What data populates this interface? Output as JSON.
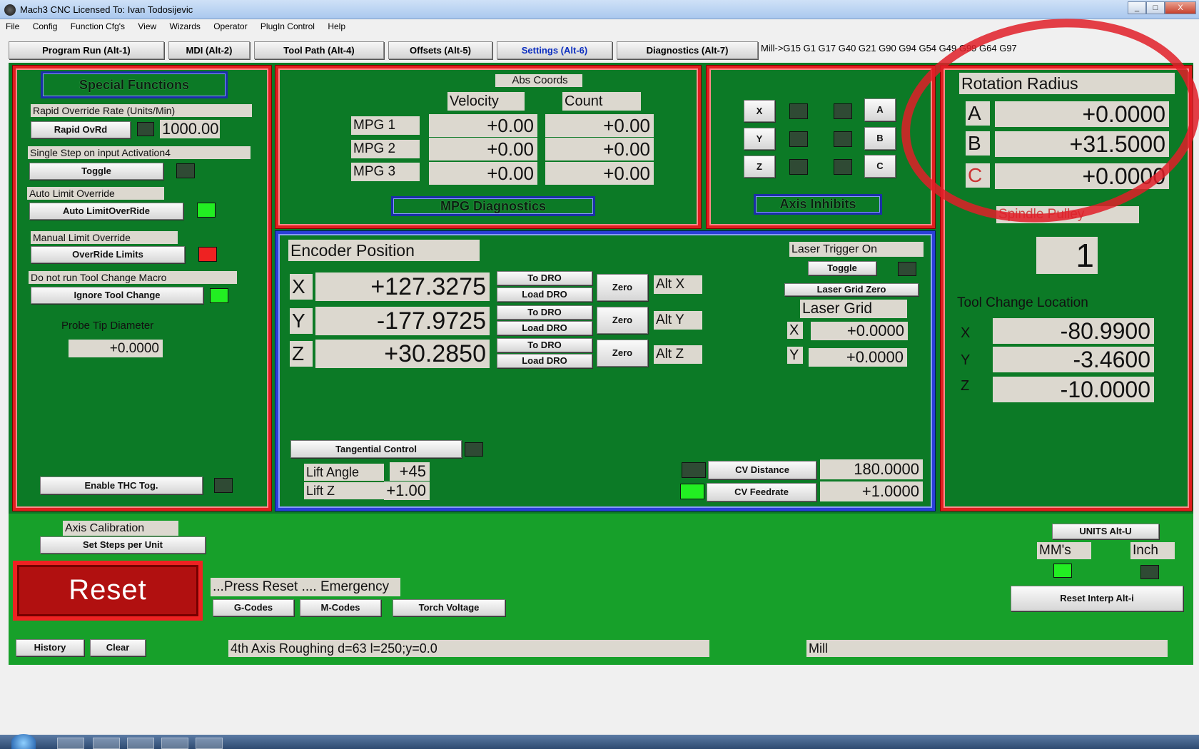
{
  "window": {
    "title": "Mach3 CNC  Licensed To: Ivan Todosijevic",
    "controls": [
      "_",
      "□",
      "X"
    ]
  },
  "menu": [
    "File",
    "Config",
    "Function Cfg's",
    "View",
    "Wizards",
    "Operator",
    "PlugIn Control",
    "Help"
  ],
  "tabs": [
    {
      "label": "Program Run (Alt-1)",
      "active": false
    },
    {
      "label": "MDI (Alt-2)",
      "active": false
    },
    {
      "label": "Tool Path (Alt-4)",
      "active": false
    },
    {
      "label": "Offsets (Alt-5)",
      "active": false
    },
    {
      "label": "Settings (Alt-6)",
      "active": true
    },
    {
      "label": "Diagnostics (Alt-7)",
      "active": false
    }
  ],
  "modal_line": "Mill->G15  G1 G17 G40 G21 G90 G94 G54 G49 G99 G64 G97",
  "special": {
    "title": "Special Functions",
    "rapid_label": "Rapid Override Rate (Units/Min)",
    "rapid_btn": "Rapid OvRd",
    "rapid_value": "1000.00",
    "single_step_label": "Single Step on input Activation4",
    "toggle_btn": "Toggle",
    "auto_limit_label": "Auto Limit Override",
    "auto_limit_btn": "Auto LimitOverRide",
    "manual_limit_label": "Manual Limit Override",
    "override_btn": "OverRide Limits",
    "tool_change_label": "Do not run Tool Change Macro",
    "ignore_btn": "Ignore Tool Change",
    "probe_label": "Probe Tip Diameter",
    "probe_value": "+0.0000",
    "thc_btn": "Enable THC Tog."
  },
  "mpg": {
    "abs_coords": "Abs Coords",
    "velocity": "Velocity",
    "count": "Count",
    "rows": [
      {
        "label": "MPG 1",
        "velocity": "+0.00",
        "count": "+0.00"
      },
      {
        "label": "MPG 2",
        "velocity": "+0.00",
        "count": "+0.00"
      },
      {
        "label": "MPG 3",
        "velocity": "+0.00",
        "count": "+0.00"
      }
    ],
    "title": "MPG Diagnostics"
  },
  "inhibits": {
    "left": [
      "X",
      "Y",
      "Z"
    ],
    "right": [
      "A",
      "B",
      "C"
    ],
    "title": "Axis Inhibits"
  },
  "rotation": {
    "title": "Rotation Radius",
    "rows": [
      {
        "axis": "A",
        "value": "+0.0000"
      },
      {
        "axis": "B",
        "value": "+31.5000"
      },
      {
        "axis": "C",
        "value": "+0.0000"
      }
    ],
    "spindle_label": "Spindle Pulley",
    "spindle_value": "1",
    "tool_change_label": "Tool Change Location",
    "tool_rows": [
      {
        "axis": "X",
        "value": "-80.9900"
      },
      {
        "axis": "Y",
        "value": "-3.4600"
      },
      {
        "axis": "Z",
        "value": "-10.0000"
      }
    ]
  },
  "encoder": {
    "title": "Encoder Position",
    "rows": [
      {
        "axis": "X",
        "value": "+127.3275",
        "alt": "Alt X"
      },
      {
        "axis": "Y",
        "value": "-177.9725",
        "alt": "Alt Y"
      },
      {
        "axis": "Z",
        "value": "+30.2850",
        "alt": "Alt Z"
      }
    ],
    "to_dro": "To DRO",
    "load_dro": "Load DRO",
    "zero": "Zero",
    "laser_trigger": "Laser Trigger On",
    "laser_toggle": "Toggle",
    "laser_grid_zero": "Laser Grid Zero",
    "laser_grid": "Laser Grid",
    "laser_x_label": "X",
    "laser_x": "+0.0000",
    "laser_y_label": "Y",
    "laser_y": "+0.0000",
    "tangential": "Tangential Control",
    "lift_angle_label": "Lift Angle",
    "lift_angle": "+45",
    "lift_z_label": "Lift Z",
    "lift_z": "+1.00",
    "cv_distance_btn": "CV Distance",
    "cv_distance": "180.0000",
    "cv_feedrate_btn": "CV Feedrate",
    "cv_feedrate": "+1.0000"
  },
  "bottom": {
    "axis_cal_label": "Axis Calibration",
    "set_steps_btn": "Set Steps per Unit",
    "reset_btn": "Reset",
    "emergency_text": "...Press Reset .... Emergency",
    "gcodes_btn": "G-Codes",
    "mcodes_btn": "M-Codes",
    "torch_btn": "Torch Voltage",
    "units_btn": "UNITS Alt-U",
    "mm_label": "MM's",
    "inch_label": "Inch",
    "reset_interp_btn": "Reset Interp Alt-i",
    "history_btn": "History",
    "clear_btn": "Clear",
    "status_text": "4th Axis Roughing d=63 l=250;y=0.0",
    "profile_text": "Mill"
  },
  "colors": {
    "panel_green": "#0c7a26",
    "bottom_green": "#17a02a",
    "panel_border": "#e01f1f",
    "encoder_border": "#2a3fd8",
    "annotation": "#e11e28"
  }
}
